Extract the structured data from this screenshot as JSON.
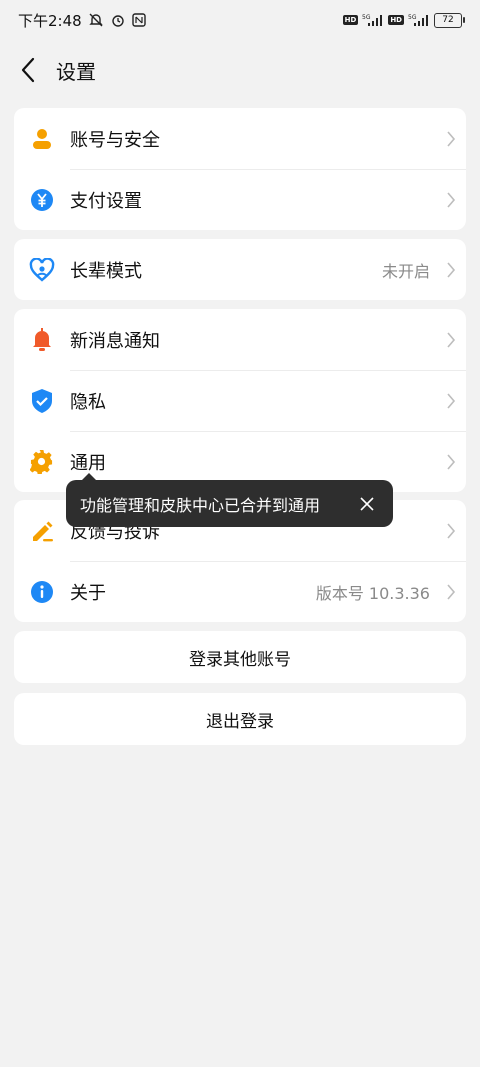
{
  "statusbar": {
    "time": "下午2:48",
    "hd": "HD",
    "net": "5G",
    "battery": "72",
    "icons": [
      "mute-bell-icon",
      "alarm-icon",
      "nfc-icon",
      "signal-icon",
      "signal-icon",
      "battery-icon"
    ]
  },
  "header": {
    "title": "设置",
    "back_icon": "back-arrow-icon"
  },
  "group1": [
    {
      "label": "账号与安全",
      "icon": "user-icon",
      "color": "#f5a000"
    },
    {
      "label": "支付设置",
      "icon": "yuan-icon",
      "color": "#1e88f5"
    }
  ],
  "group2": [
    {
      "label": "长辈模式",
      "value": "未开启",
      "icon": "heart-person-icon",
      "color": "#1e88f5"
    }
  ],
  "group3": [
    {
      "label": "新消息通知",
      "icon": "bell-icon",
      "color": "#f05a2a"
    },
    {
      "label": "隐私",
      "icon": "shield-check-icon",
      "color": "#1e88f5"
    },
    {
      "label": "通用",
      "icon": "gear-icon",
      "color": "#f5a000"
    }
  ],
  "group4": [
    {
      "label": "反馈与投诉",
      "icon": "pencil-icon",
      "color": "#f5a000"
    },
    {
      "label": "关于",
      "value": "版本号 10.3.36",
      "icon": "info-icon",
      "color": "#1e88f5"
    }
  ],
  "buttons": {
    "switch_account": "登录其他账号",
    "logout": "退出登录"
  },
  "tooltip": {
    "text": "功能管理和皮肤中心已合并到通用",
    "close_icon": "close-icon"
  }
}
